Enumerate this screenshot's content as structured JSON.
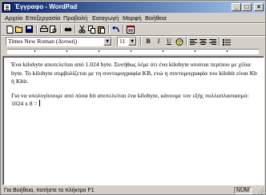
{
  "window": {
    "title": "Έγγραφο - WordPad",
    "min": "_",
    "max": "□",
    "close": "×"
  },
  "menu": [
    "Αρχείο",
    "Επεξεργασία",
    "Προβολή",
    "Εισαγωγή",
    "Μορφή",
    "Βοήθεια"
  ],
  "toolbar": {
    "icons": [
      "new-icon",
      "open-icon",
      "save-icon",
      "print-icon",
      "print-preview-icon",
      "find-icon",
      "cut-icon",
      "copy-icon",
      "paste-icon",
      "undo-icon",
      "date-time-icon"
    ]
  },
  "format": {
    "font": "Times New Roman (Δυτική)",
    "size": "11",
    "bold": "B",
    "italic": "I",
    "underline": "U",
    "colors": {
      "accent": "#0a246a",
      "face": "#d4d0c8"
    }
  },
  "document": {
    "paragraph1": "Ένα kilobyte αποτελείται από 1.024 byte. Συνήθως λέμε ότι ένα kilobyte ισούται περίπου με χίλια byte. Το kilobyte συμβολίζεται με τη συντομογραφία KB, ενώ η συντομογραφία του kilobit είναι Kb ή Kbit.",
    "paragraph2": "Για να υπολογίσουμε από πόσα bit αποτελείται ένα kilobyte, κάνουμε τον εξής πολλαπλασιασμό: 1024 x 8 ="
  },
  "status": {
    "text": "Για Βοήθεια, πατήστε το πλήκτρο F1",
    "num": "NUM"
  }
}
